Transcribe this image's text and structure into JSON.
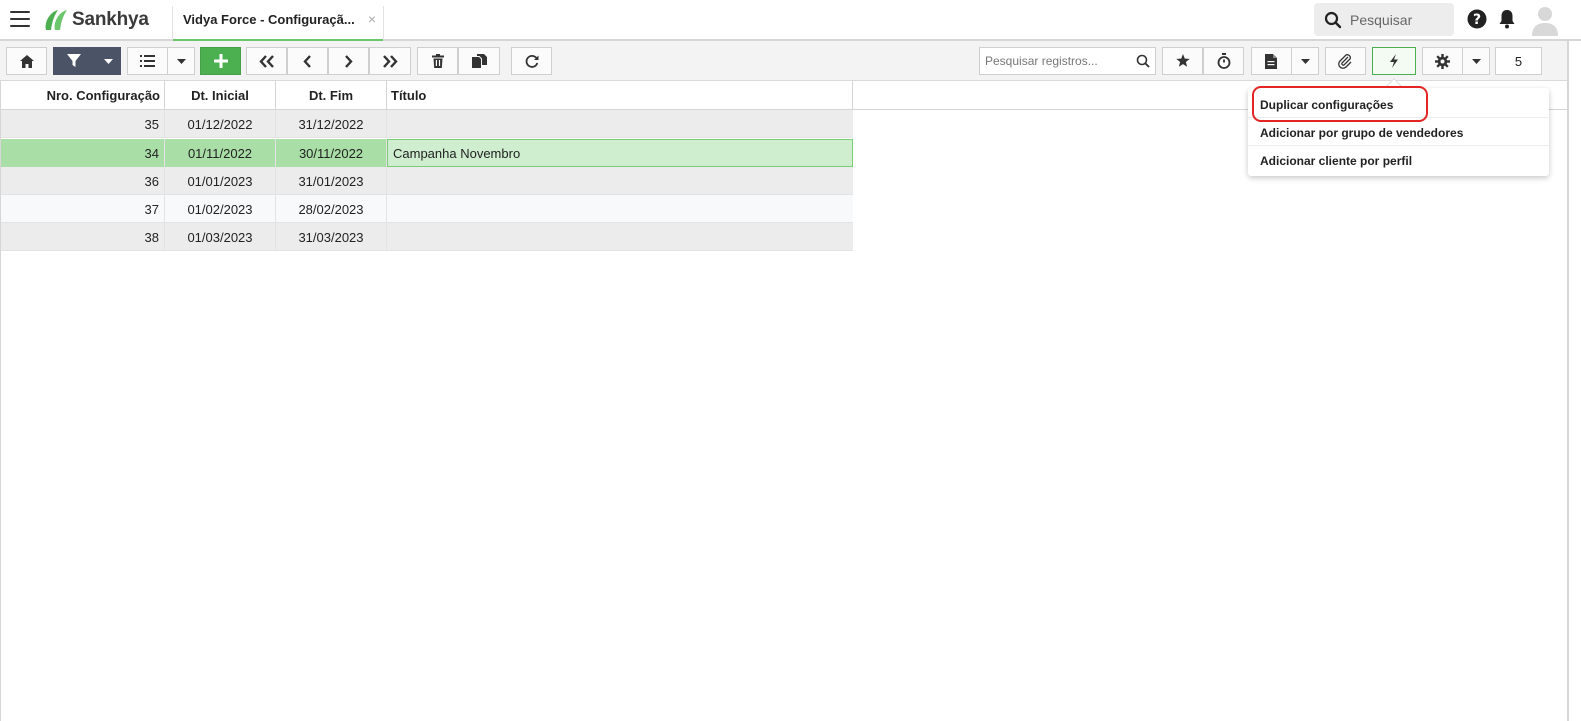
{
  "header": {
    "brand": "Sankhya",
    "tab_title": "Vidya Force - Configuraçã...",
    "tab_close": "×",
    "search_placeholder": "Pesquisar"
  },
  "toolbar": {
    "search_records_placeholder": "Pesquisar registros...",
    "record_count": "5"
  },
  "table": {
    "columns": [
      "Nro. Configuração",
      "Dt. Inicial",
      "Dt. Fim",
      "Título"
    ],
    "rows": [
      {
        "nro": "35",
        "inicial": "01/12/2022",
        "fim": "31/12/2022",
        "titulo": ""
      },
      {
        "nro": "34",
        "inicial": "01/11/2022",
        "fim": "30/11/2022",
        "titulo": "Campanha Novembro"
      },
      {
        "nro": "36",
        "inicial": "01/01/2023",
        "fim": "31/01/2023",
        "titulo": ""
      },
      {
        "nro": "37",
        "inicial": "01/02/2023",
        "fim": "28/02/2023",
        "titulo": ""
      },
      {
        "nro": "38",
        "inicial": "01/03/2023",
        "fim": "31/03/2023",
        "titulo": ""
      }
    ]
  },
  "actions_menu": {
    "items": [
      "Duplicar configurações",
      "Adicionar por grupo de vendedores",
      "Adicionar cliente por perfil"
    ]
  },
  "colors": {
    "accent_green": "#4caf50",
    "selected_row": "#cfeecf",
    "highlight_red": "#e42525",
    "filter_button": "#4a5466"
  }
}
